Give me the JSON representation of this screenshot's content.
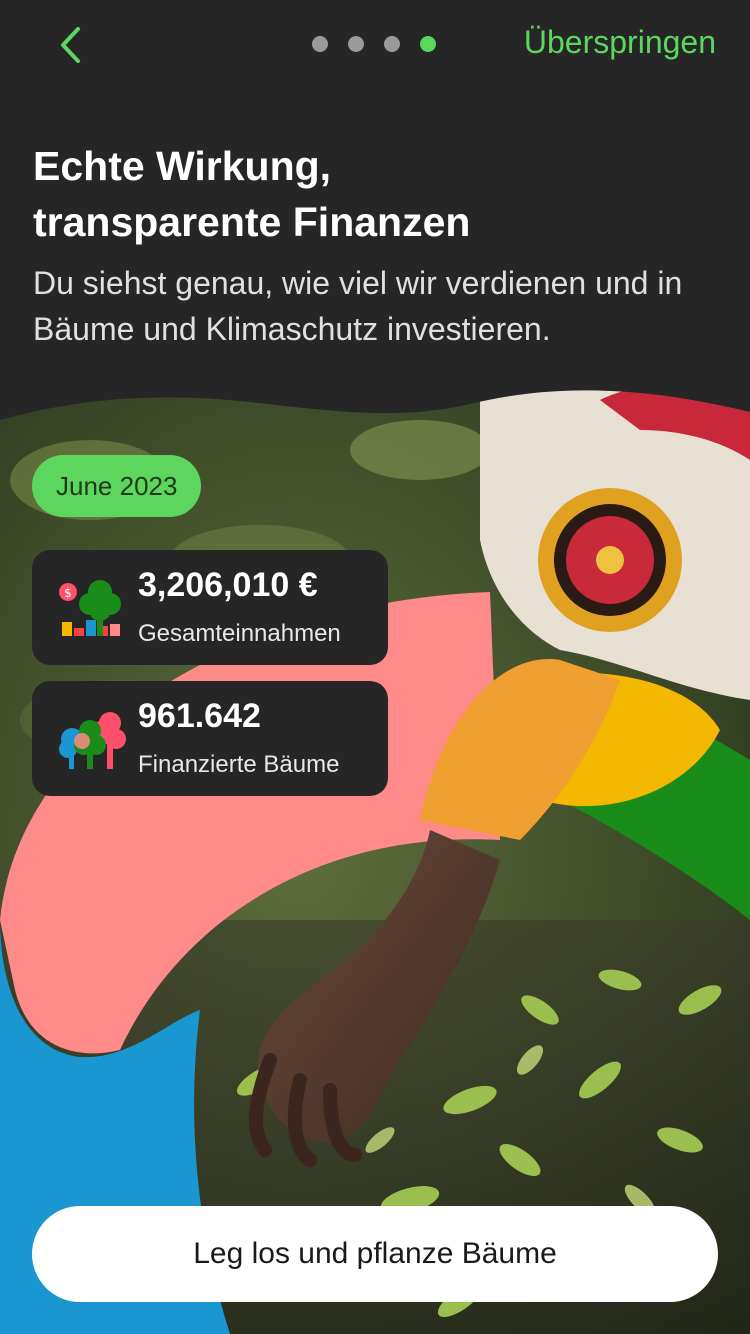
{
  "nav": {
    "back_icon": "chevron-left-icon",
    "pager": {
      "total": 4,
      "active": 4
    },
    "skip_label": "Überspringen"
  },
  "header": {
    "title_line1": "Echte Wirkung,",
    "title_line2": "transparente Finanzen",
    "subtitle": "Du siehst genau, wie viel wir verdienen und in Bäume und Klimaschutz investieren."
  },
  "report": {
    "month": "June 2023",
    "stats": [
      {
        "icon": "revenue-chart-icon",
        "value": "3,206,010 €",
        "label": "Gesamteinnahmen"
      },
      {
        "icon": "trees-icon",
        "value": "961.642",
        "label": "Finanzierte Bäume"
      }
    ]
  },
  "cta": {
    "label": "Leg los und pflanze Bäume"
  },
  "colors": {
    "accent_green": "#5cd65c",
    "background_dark": "#262626",
    "shape_pink": "#ff8a8a",
    "shape_blue": "#1a96d0",
    "shape_yellow": "#f5b800",
    "shape_green": "#1a8c1a"
  }
}
